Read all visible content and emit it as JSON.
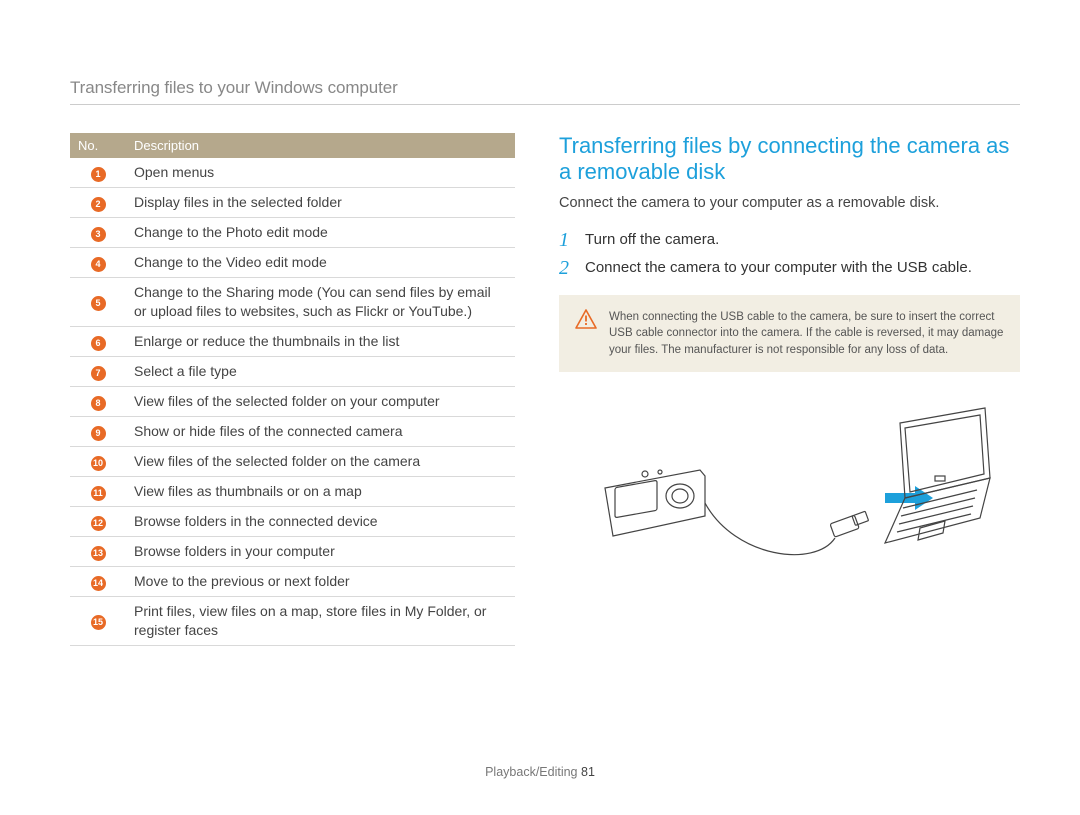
{
  "page_title": "Transferring files to your Windows computer",
  "table": {
    "headers": {
      "no": "No.",
      "desc": "Description"
    },
    "rows": [
      {
        "n": "1",
        "d": "Open menus"
      },
      {
        "n": "2",
        "d": "Display files in the selected folder"
      },
      {
        "n": "3",
        "d": "Change to the Photo edit mode"
      },
      {
        "n": "4",
        "d": "Change to the Video edit mode"
      },
      {
        "n": "5",
        "d": "Change to the Sharing mode (You can send files by email or upload files to websites, such as Flickr or YouTube.)"
      },
      {
        "n": "6",
        "d": "Enlarge or reduce the thumbnails in the list"
      },
      {
        "n": "7",
        "d": "Select a file type"
      },
      {
        "n": "8",
        "d": "View files of the selected folder on your computer"
      },
      {
        "n": "9",
        "d": "Show or hide files of the connected camera"
      },
      {
        "n": "10",
        "d": "View files of the selected folder on the camera"
      },
      {
        "n": "11",
        "d": "View files as thumbnails or on a map"
      },
      {
        "n": "12",
        "d": "Browse folders in the connected device"
      },
      {
        "n": "13",
        "d": "Browse folders in your computer"
      },
      {
        "n": "14",
        "d": "Move to the previous or next folder"
      },
      {
        "n": "15",
        "d": "Print files, view files on a map, store files in My Folder, or register faces"
      }
    ]
  },
  "section_title": "Transferring files by connecting the camera as a removable disk",
  "intro": "Connect the camera to your computer as a removable disk.",
  "steps": [
    {
      "n": "1",
      "t": "Turn off the camera."
    },
    {
      "n": "2",
      "t": "Connect the camera to your computer with the USB cable."
    }
  ],
  "caution": "When connecting the USB cable to the camera, be sure to insert the correct USB cable connector into the camera. If the cable is reversed, it may damage your files. The manufacturer is not responsible for any loss of data.",
  "footer": {
    "section": "Playback/Editing",
    "page": "81"
  }
}
